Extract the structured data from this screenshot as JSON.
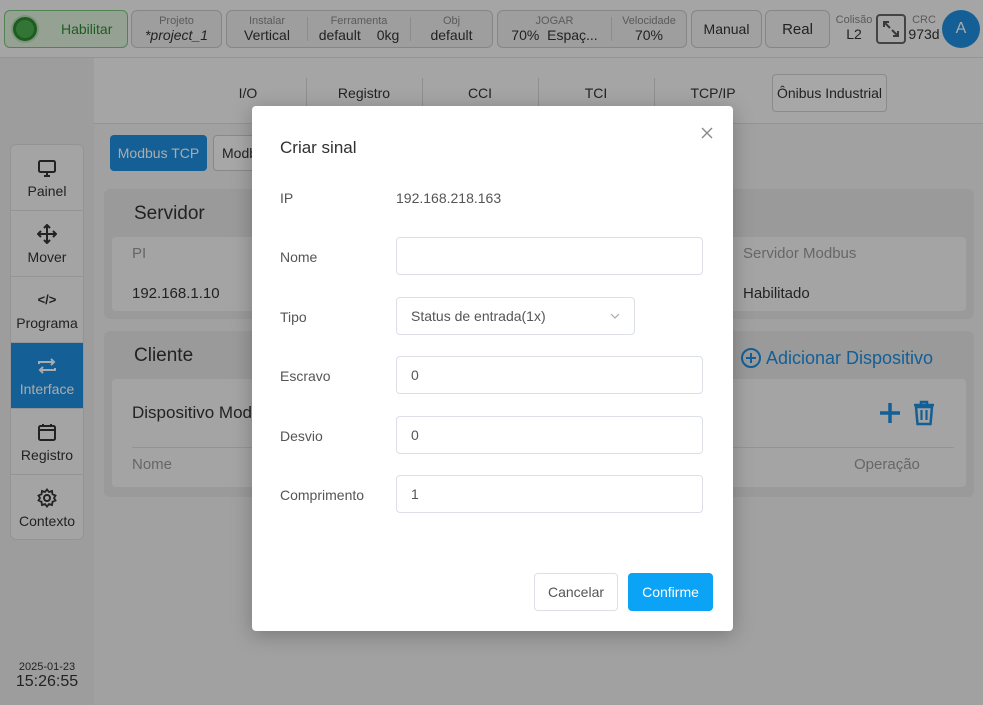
{
  "topbar": {
    "enable_label": "Habilitar",
    "project": {
      "caption": "Projeto",
      "value": "*project_1"
    },
    "install": {
      "caption": "Instalar",
      "value": "Vertical"
    },
    "tool": {
      "caption": "Ferramenta",
      "value": "default",
      "weight": "0kg"
    },
    "obj": {
      "caption": "Obj",
      "value": "default"
    },
    "jog": {
      "caption": "JOGAR",
      "value": "70%",
      "space": "Espaç..."
    },
    "speed": {
      "caption": "Velocidade",
      "value": "70%"
    },
    "manual_label": "Manual",
    "real_label": "Real",
    "collision": {
      "caption": "Colisão",
      "value": "L2"
    },
    "crc": {
      "caption": "CRC",
      "value": "973d"
    },
    "avatar": "A"
  },
  "sidebar": {
    "items": [
      {
        "label": "Painel",
        "icon": "monitor-icon"
      },
      {
        "label": "Mover",
        "icon": "move-icon"
      },
      {
        "label": "Programa",
        "icon": "code-icon"
      },
      {
        "label": "Interface",
        "icon": "swap-icon",
        "active": true
      },
      {
        "label": "Registro",
        "icon": "calendar-icon"
      },
      {
        "label": "Contexto",
        "icon": "gear-icon"
      }
    ],
    "date": "2025-01-23",
    "time": "15:26:55"
  },
  "tabs": [
    "I/O",
    "Registro",
    "CCI",
    "TCI",
    "TCP/IP",
    "Ônibus Industrial"
  ],
  "subtabs": [
    "Modbus TCP",
    "Modb"
  ],
  "server": {
    "title": "Servidor",
    "col_ip": "PI",
    "val_ip": "192.168.1.10",
    "col_modbus": "Servidor Modbus",
    "val_modbus": "Habilitado"
  },
  "client": {
    "title": "Cliente",
    "add_device": "Adicionar Dispositivo",
    "device_label": "Dispositivo Mod",
    "col_name": "Nome",
    "col_op": "Operação"
  },
  "dialog": {
    "title": "Criar sinal",
    "ip_label": "IP",
    "ip_value": "192.168.218.163",
    "name_label": "Nome",
    "name_value": "",
    "type_label": "Tipo",
    "type_value": "Status de entrada(1x)",
    "slave_label": "Escravo",
    "slave_value": "0",
    "offset_label": "Desvio",
    "offset_value": "0",
    "length_label": "Comprimento",
    "length_value": "1",
    "cancel_label": "Cancelar",
    "confirm_label": "Confirme"
  },
  "colors": {
    "accent": "#1e8ee0",
    "confirm": "#0aa3f5",
    "enable": "#4caf50"
  }
}
